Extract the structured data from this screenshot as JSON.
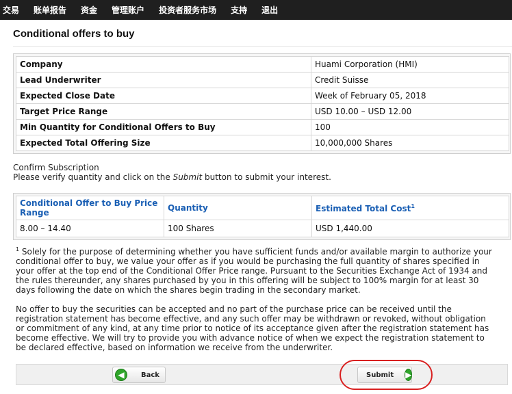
{
  "nav": {
    "items": [
      "交易",
      "账单报告",
      "资金",
      "管理账户",
      "投资者服务市场",
      "支持",
      "退出"
    ]
  },
  "page": {
    "title": "Conditional offers to buy"
  },
  "details": {
    "rows": [
      {
        "label": "Company",
        "value": "Huami Corporation (HMI)"
      },
      {
        "label": "Lead Underwriter",
        "value": "Credit Suisse"
      },
      {
        "label": "Expected Close Date",
        "value": "Week of February 05, 2018"
      },
      {
        "label": "Target Price Range",
        "value": "USD 10.00 – USD 12.00"
      },
      {
        "label": "Min Quantity for Conditional Offers to Buy",
        "value": "100"
      },
      {
        "label": "Expected Total Offering Size",
        "value": "10,000,000 Shares"
      }
    ]
  },
  "confirm": {
    "heading": "Confirm Subscription",
    "pre": "Please verify quantity and click on the ",
    "em": "Submit",
    "post": " button to submit your interest."
  },
  "summary": {
    "headers": [
      "Conditional Offer to Buy Price Range",
      "Quantity",
      "Estimated Total Cost"
    ],
    "footnote_mark": "1",
    "row": [
      "8.00 – 14.40",
      "100 Shares",
      "USD 1,440.00"
    ]
  },
  "notes": {
    "mark": "1",
    "p1": " Solely for the purpose of determining whether you have sufficient funds and/or available margin to authorize your conditional offer to buy, we value your offer as if you would be purchasing the full quantity of shares specified in your offer at the top end of the Conditional Offer Price range. Pursuant to the Securities Exchange Act of 1934 and the rules thereunder, any shares purchased by you in this offering will be subject to 100% margin for at least 30 days following the date on which the shares begin trading in the secondary market.",
    "p2": "No offer to buy the securities can be accepted and no part of the purchase price can be received until the registration statement has become effective, and any such offer may be withdrawn or revoked, without obligation or commitment of any kind, at any time prior to notice of its acceptance given after the registration statement has become effective. We will try to provide you with advance notice of when we expect the registration statement to be declared effective, based on information we receive from the underwriter."
  },
  "buttons": {
    "back": "Back",
    "submit": "Submit"
  },
  "colors": {
    "nav_bg": "#1f1f1f",
    "link_blue": "#1a5fb4",
    "highlight_red": "#d92020",
    "icon_green": "#2fa52a"
  }
}
